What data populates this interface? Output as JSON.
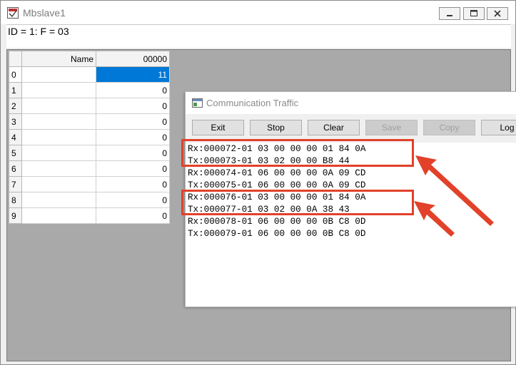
{
  "window": {
    "title": "Mbslave1",
    "status": "ID = 1: F = 03"
  },
  "grid": {
    "columns": [
      "Name",
      "00000"
    ],
    "rows": [
      {
        "index": "0",
        "name": "",
        "value": "11",
        "selected": true
      },
      {
        "index": "1",
        "name": "",
        "value": "0"
      },
      {
        "index": "2",
        "name": "",
        "value": "0"
      },
      {
        "index": "3",
        "name": "",
        "value": "0"
      },
      {
        "index": "4",
        "name": "",
        "value": "0"
      },
      {
        "index": "5",
        "name": "",
        "value": "0"
      },
      {
        "index": "6",
        "name": "",
        "value": "0"
      },
      {
        "index": "7",
        "name": "",
        "value": "0"
      },
      {
        "index": "8",
        "name": "",
        "value": "0"
      },
      {
        "index": "9",
        "name": "",
        "value": "0"
      }
    ]
  },
  "traffic": {
    "title": "Communication Traffic",
    "buttons": {
      "exit": "Exit",
      "stop": "Stop",
      "clear": "Clear",
      "save": "Save",
      "copy": "Copy",
      "log": "Log"
    },
    "lines": [
      "Rx:000072-01 03 00 00 00 01 84 0A",
      "Tx:000073-01 03 02 00 00 B8 44",
      "Rx:000074-01 06 00 00 00 0A 09 CD",
      "Tx:000075-01 06 00 00 00 0A 09 CD",
      "Rx:000076-01 03 00 00 00 01 84 0A",
      "Tx:000077-01 03 02 00 0A 38 43",
      "Rx:000078-01 06 00 00 00 0B C8 0D",
      "Tx:000079-01 06 00 00 00 0B C8 0D"
    ]
  },
  "colors": {
    "selection": "#0078d7",
    "annotation": "#e2412a"
  }
}
